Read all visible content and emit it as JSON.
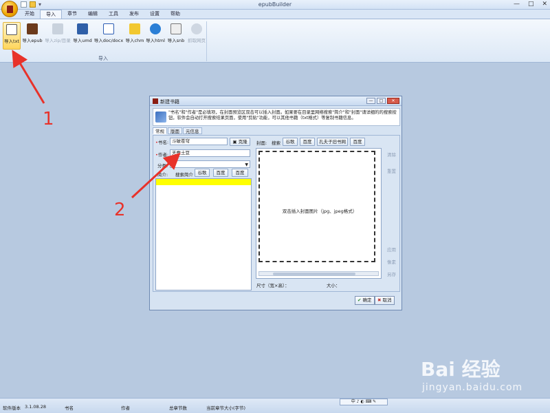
{
  "app": {
    "title": "epubBuilder",
    "window_controls": [
      "—",
      "□",
      "✕"
    ],
    "qat_more": "▾"
  },
  "tabs": [
    "开始",
    "导入",
    "章节",
    "编辑",
    "工具",
    "发布",
    "设置",
    "帮助"
  ],
  "ribbon": {
    "group_label": "导入",
    "buttons": [
      {
        "label": "导入txt",
        "icon": "txt-file-icon"
      },
      {
        "label": "导入epub",
        "icon": "epub-book-icon"
      },
      {
        "label": "导入zip/目录",
        "icon": "zip-folder-icon"
      },
      {
        "label": "导入umd",
        "icon": "umd-file-icon"
      },
      {
        "label": "导入doc/docx",
        "icon": "word-doc-icon"
      },
      {
        "label": "导入chm",
        "icon": "chm-help-icon"
      },
      {
        "label": "导入html",
        "icon": "ie-browser-icon"
      },
      {
        "label": "导入snb",
        "icon": "snb-file-icon"
      },
      {
        "label": "抓取网页",
        "icon": "web-grab-icon"
      }
    ]
  },
  "dialog": {
    "title": "新建书籍",
    "hint": "\"书名\"和\"作者\"是必填项，在封面预览区双击可以插入封面。如果要在目录里网络搜索\"简介\"和\"封面\"请详细的的搜索按钮，软件会自动打开搜索结果页面，使用\"剪贴\"功能，可以其他书籍（txt格式）等复制书籍信息。",
    "tabs": [
      "常规",
      "版面",
      "元信息"
    ],
    "fields": {
      "title_label": "书名:",
      "title_value": "斗破苍穹",
      "clone_button": "克隆",
      "author_label": "作者:",
      "author_value": "天蚕土豆",
      "category_label": "分类:",
      "intro_label": "简介:",
      "search_intro_label": "搜索简介",
      "intro_buttons": [
        "谷歌",
        "百度",
        "百度"
      ]
    },
    "cover": {
      "label": "封面:",
      "search_label": "搜索",
      "buttons": [
        "谷歌",
        "百度",
        "孔夫子旧书网",
        "百度"
      ],
      "placeholder": "双击插入封面图片（jpg、jpeg格式）",
      "side_links_top": [
        "清除",
        "重置"
      ],
      "side_links_bottom": [
        "应用",
        "像素",
        "另存"
      ],
      "size_label": "尺寸（宽×高）：",
      "filesize_label": "大小："
    },
    "ok_label": "确定",
    "cancel_label": "取消"
  },
  "annotations": [
    "1",
    "2"
  ],
  "watermark": {
    "logo": "Bai 经验",
    "url": "jingyan.baidu.com"
  },
  "statusbar": {
    "items": [
      "软件版本",
      "3.1.08.28",
      "书名",
      "作者",
      "总章节数",
      "当前章节大小(字节)"
    ],
    "ime": "中 ♪ ◐ ⌨ ✎"
  },
  "colors": {
    "accent": "#e8322a",
    "ribbon_hover": "#ffd65c",
    "highlight": "#ffff00"
  }
}
